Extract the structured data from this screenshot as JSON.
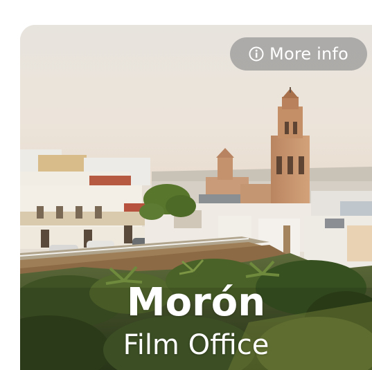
{
  "card": {
    "button": {
      "icon": "info-icon",
      "label": "More info"
    },
    "title": "Morón",
    "subtitle": "Film Office"
  },
  "colors": {
    "sky": "#eae4dc",
    "stone": "#c79873",
    "foliage": "#3d5426",
    "button_bg": "#979797"
  }
}
